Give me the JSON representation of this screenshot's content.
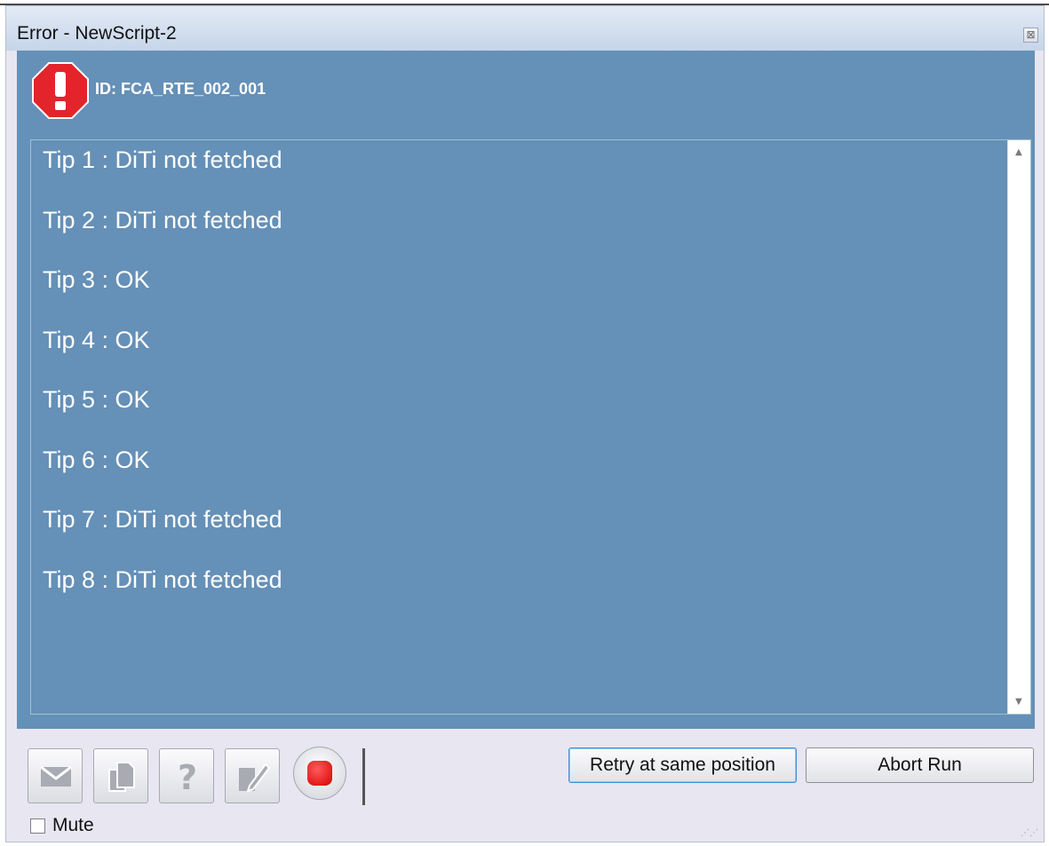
{
  "window": {
    "title": "Error - NewScript-2",
    "close_glyph": "⊠"
  },
  "error": {
    "id_text": "ID: FCA_RTE_002_001"
  },
  "messages": [
    "Tip 1 : DiTi not fetched",
    "Tip 2 : DiTi not fetched",
    "Tip 3 : OK",
    "Tip 4 : OK",
    "Tip 5 : OK",
    "Tip 6 : OK",
    "Tip 7 : DiTi not fetched",
    "Tip 8 : DiTi not fetched"
  ],
  "toolbar": {
    "icons": [
      "mail-icon",
      "copy-icon",
      "help-icon",
      "note-icon",
      "stop-icon"
    ]
  },
  "actions": {
    "retry_label": "Retry at same position",
    "abort_label": "Abort Run"
  },
  "mute": {
    "label": "Mute",
    "checked": false
  },
  "colors": {
    "panel_blue": "#6590b7",
    "error_red": "#e3242b"
  }
}
